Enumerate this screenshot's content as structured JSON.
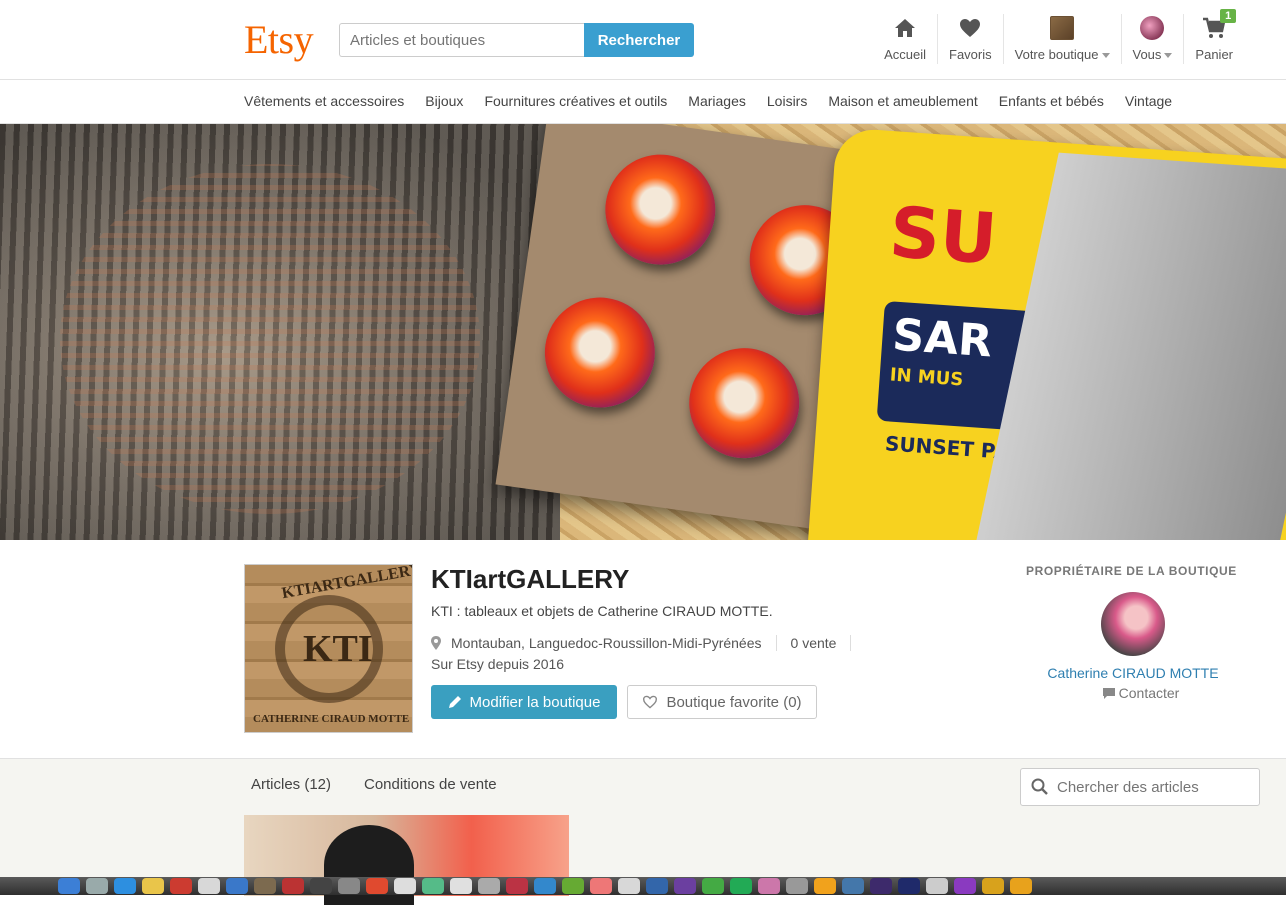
{
  "header": {
    "logo": "Etsy",
    "search_placeholder": "Articles et boutiques",
    "search_button": "Rechercher",
    "nav": [
      {
        "label": "Accueil",
        "icon": "home-icon"
      },
      {
        "label": "Favoris",
        "icon": "heart-icon"
      },
      {
        "label": "Votre boutique",
        "icon": "shop-icon"
      },
      {
        "label": "Vous",
        "icon": "avatar"
      },
      {
        "label": "Panier",
        "icon": "cart-icon",
        "badge": "1"
      }
    ]
  },
  "categories": [
    "Vêtements et accessoires",
    "Bijoux",
    "Fournitures créatives et outils",
    "Mariages",
    "Loisirs",
    "Maison et ameublement",
    "Enfants et bébés",
    "Vintage"
  ],
  "shop": {
    "logo_top": "KTIARTGALLERY",
    "logo_mono": "KTI",
    "logo_bottom": "CATHERINE CIRAUD MOTTE",
    "name": "KTIartGALLERY",
    "title": "KTI : tableaux et objets de Catherine CIRAUD MOTTE.",
    "location": "Montauban, Languedoc-Roussillon-Midi-Pyrénées",
    "sales": "0 vente",
    "since": "Sur Etsy depuis 2016",
    "edit_button": "Modifier la boutique",
    "favorite_button": "Boutique favorite (0)"
  },
  "owner": {
    "heading": "PROPRIÉTAIRE DE LA BOUTIQUE",
    "name": "Catherine CIRAUD MOTTE",
    "contact": "Contacter"
  },
  "banner": {
    "tin_text": "SU",
    "tin_sub": "SAR",
    "tin_line2": "IN MUS",
    "tin_line3": "SUNSET PAC"
  },
  "tabs": {
    "articles": "Articles (12)",
    "conditions": "Conditions de vente",
    "search_placeholder": "Chercher des articles"
  },
  "colors": {
    "brand": "#f56400",
    "accent": "#3a9fd0",
    "link": "#2f7fb0"
  }
}
